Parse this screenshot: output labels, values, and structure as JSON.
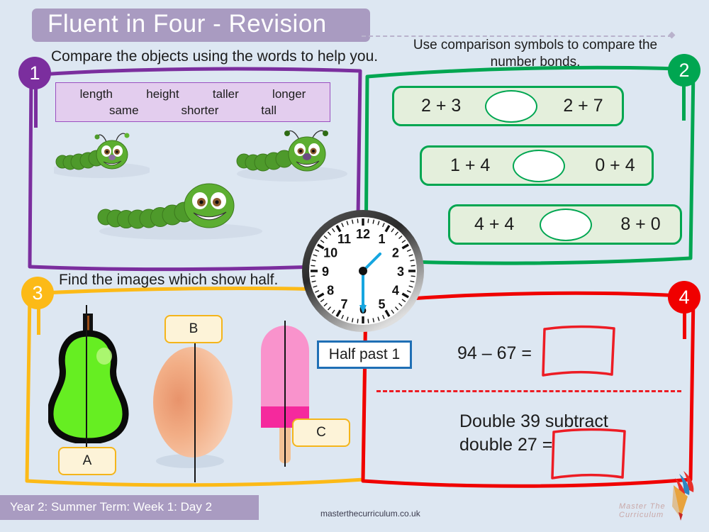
{
  "header": {
    "title": "Fluent in Four - Revision"
  },
  "q1": {
    "number": "1",
    "prompt": "Compare the objects using the words to help you.",
    "word_bank_row1": [
      "length",
      "height",
      "taller",
      "longer"
    ],
    "word_bank_row2": [
      "same",
      "shorter",
      "tall"
    ],
    "objects": [
      "caterpillar-short",
      "caterpillar-long",
      "caterpillar-medium"
    ],
    "accent_color": "#7B2E9E"
  },
  "q2": {
    "number": "2",
    "prompt": "Use comparison symbols to compare the number bonds.",
    "rows": [
      {
        "left": "2 + 3",
        "answer": "",
        "right": "2 + 7"
      },
      {
        "left": "1 + 4",
        "answer": "",
        "right": "0 + 4"
      },
      {
        "left": "4 + 4",
        "answer": "",
        "right": "8 + 0"
      }
    ],
    "accent_color": "#00A651"
  },
  "q3": {
    "number": "3",
    "prompt": "Find the images which show half.",
    "items": [
      {
        "label": "A",
        "object": "pear"
      },
      {
        "label": "B",
        "object": "egg"
      },
      {
        "label": "C",
        "object": "ice-lolly"
      }
    ],
    "accent_color": "#FCBA17"
  },
  "q4": {
    "number": "4",
    "problem1": "94 – 67 =",
    "problem2_line1": "Double 39 subtract",
    "problem2_line2": "double 27 =",
    "answer1": "",
    "answer2": "",
    "accent_color": "#F00000"
  },
  "clock": {
    "hour_numbers": [
      "12",
      "1",
      "2",
      "3",
      "4",
      "5",
      "6",
      "7",
      "8",
      "9",
      "10",
      "11"
    ],
    "label": "Half past 1",
    "hour_hand_angle": 45,
    "minute_hand_angle": 180,
    "hand_color": "#16A6E0",
    "border_color": "#1F6FB5"
  },
  "footer": {
    "lesson": "Year 2: Summer Term: Week  1: Day 2",
    "website": "masterthecurriculum.co.uk",
    "brand": "Master  The  Curriculum"
  }
}
